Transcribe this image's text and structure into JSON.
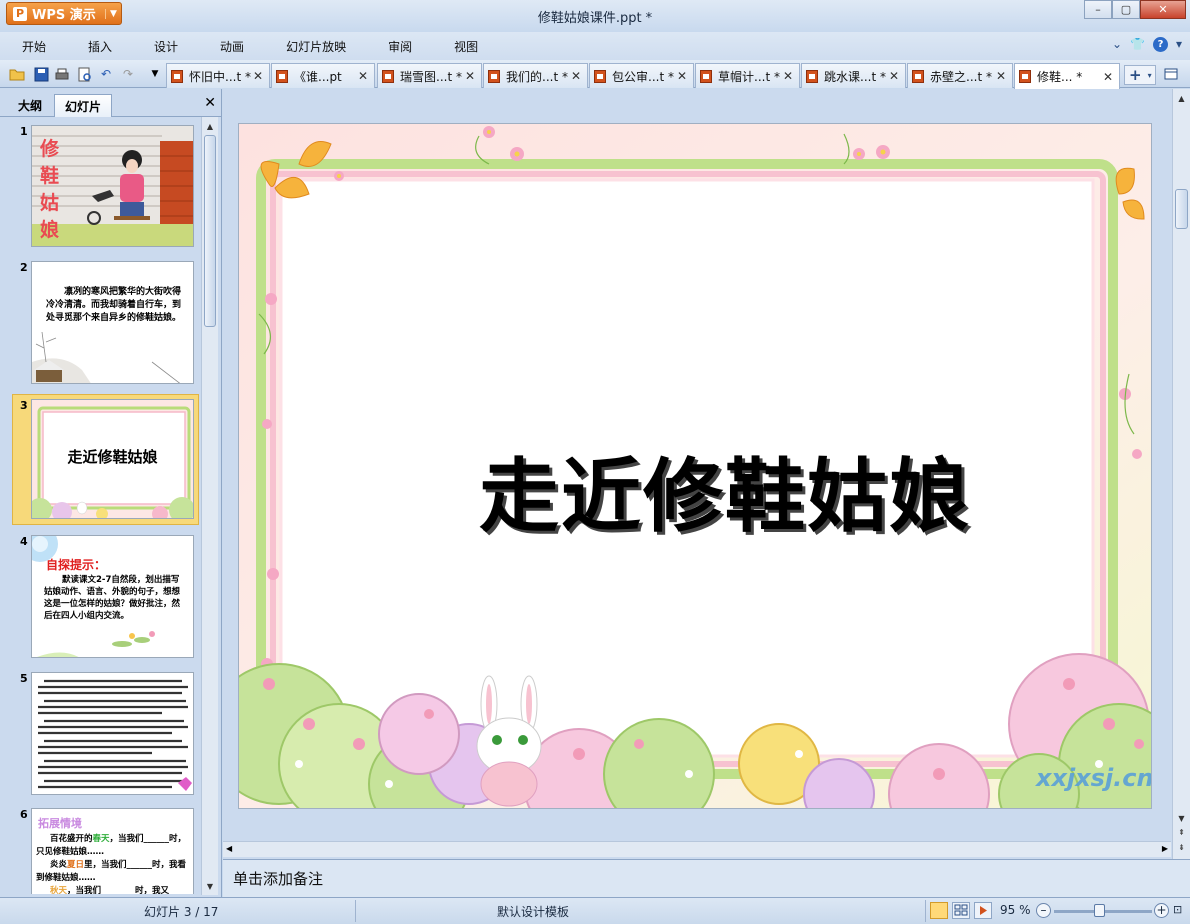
{
  "app": {
    "brand": "WPS 演示",
    "document_title": "修鞋姑娘课件.ppt *"
  },
  "menu": [
    "开始",
    "插入",
    "设计",
    "动画",
    "幻灯片放映",
    "审阅",
    "视图"
  ],
  "tabs": [
    {
      "label": "怀旧中...t *"
    },
    {
      "label": "《谁...pt"
    },
    {
      "label": "瑞雪图...t *"
    },
    {
      "label": "我们的...t *"
    },
    {
      "label": "包公审...t *"
    },
    {
      "label": "草帽计...t *"
    },
    {
      "label": "跳水课...t *"
    },
    {
      "label": "赤壁之...t *"
    },
    {
      "label": "修鞋... *"
    }
  ],
  "panel": {
    "tab_outline": "大纲",
    "tab_slides": "幻灯片"
  },
  "thumbnails": [
    {
      "num": "1",
      "title": "修鞋姑娘"
    },
    {
      "num": "2",
      "text": "凛冽的寒风把繁华的大街吹得冷冷清清。而我却骑着自行车，到处寻觅那个来自异乡的修鞋姑娘。"
    },
    {
      "num": "3",
      "text": "走近修鞋姑娘"
    },
    {
      "num": "4",
      "heading": "自探提示：",
      "text": "默读课文2-7自然段，划出描写姑娘动作、语言、外貌的句子，想想这是一位怎样的姑娘？做好批注，然后在四人小组内交流。"
    },
    {
      "num": "5"
    },
    {
      "num": "6",
      "heading": "拓展情境",
      "line1_pre": "百花盛开的",
      "line1_highlight": "春天",
      "line1_post": "，当我们______时，只见修鞋姑娘……",
      "line2_pre": "炎炎",
      "line2_highlight": "夏日",
      "line2_post": "里，当我们______时，我看到修鞋姑娘……",
      "line3_highlight": "秋天",
      "line3_post": "，当我们________时，我又"
    }
  ],
  "slide": {
    "title": "走近修鞋姑娘",
    "watermark": "xxjxsj.cn"
  },
  "notes_placeholder": "单击添加备注",
  "status": {
    "slide_counter": "幻灯片 3 / 17",
    "template": "默认设计模板",
    "zoom": "95 %"
  }
}
